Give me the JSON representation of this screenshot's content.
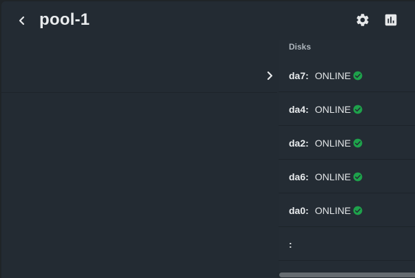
{
  "header": {
    "title": "pool-1",
    "back_icon": "chevron-left-icon",
    "settings_icon": "gear-icon",
    "stats_icon": "bar-chart-icon"
  },
  "disks": {
    "heading": "Disks",
    "rows": [
      {
        "name": "da7:",
        "status": "ONLINE",
        "status_icon": "check-circle-icon"
      },
      {
        "name": "da4:",
        "status": "ONLINE",
        "status_icon": "check-circle-icon"
      },
      {
        "name": "da2:",
        "status": "ONLINE",
        "status_icon": "check-circle-icon"
      },
      {
        "name": "da6:",
        "status": "ONLINE",
        "status_icon": "check-circle-icon"
      },
      {
        "name": "da0:",
        "status": "ONLINE",
        "status_icon": "check-circle-icon"
      },
      {
        "name": ":",
        "status": "",
        "status_icon": ""
      }
    ]
  },
  "colors": {
    "background": "#232b33",
    "online_green": "#1ea24b",
    "text": "#e6e8ea",
    "muted_text": "#aeb6bd"
  }
}
